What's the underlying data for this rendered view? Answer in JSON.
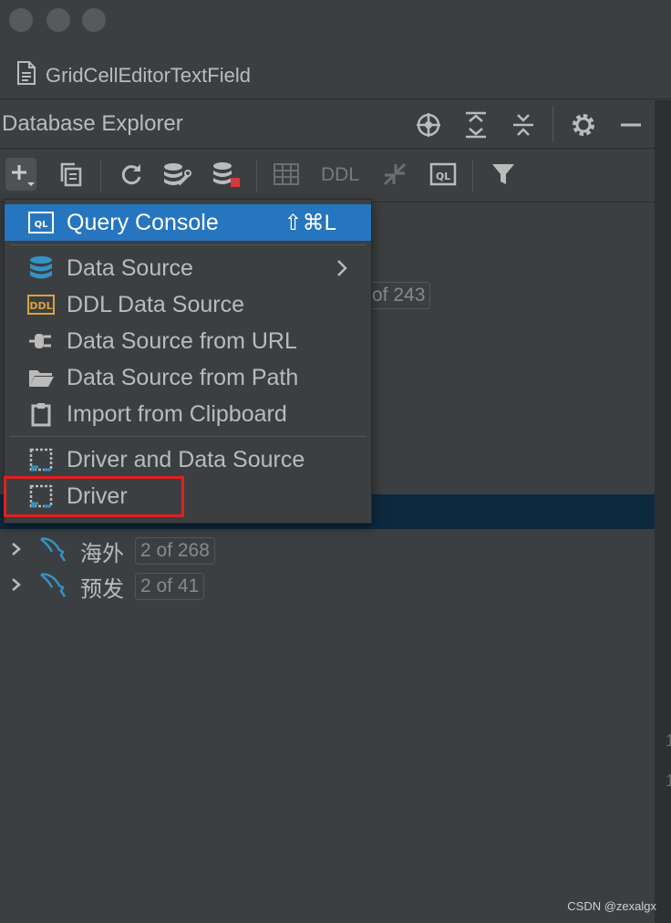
{
  "window": {
    "file_title": "GridCellEditorTextField"
  },
  "panel": {
    "title": "Database Explorer"
  },
  "toolbar": {
    "ddl_label": "DDL"
  },
  "popup_menu": {
    "items": [
      {
        "label": "Query Console",
        "shortcut": "⇧⌘L",
        "icon": "query-console-icon",
        "active": true
      },
      {
        "label": "Data Source",
        "icon": "data-source-icon",
        "submenu": true
      },
      {
        "label": "DDL Data Source",
        "icon": "ddl-icon"
      },
      {
        "label": "Data Source from URL",
        "icon": "plug-icon"
      },
      {
        "label": "Data Source from Path",
        "icon": "folder-icon"
      },
      {
        "label": "Import from Clipboard",
        "icon": "clipboard-icon"
      },
      {
        "label": "Driver and Data Source",
        "icon": "driver-icon"
      },
      {
        "label": "Driver",
        "icon": "driver-icon",
        "highlighted": true
      }
    ],
    "submenu_arrow": "›"
  },
  "tree": {
    "partial_badge": "of 243",
    "items": [
      {
        "label": "海外",
        "count": "2 of 268",
        "icon": "mysql-dolphin-icon"
      },
      {
        "label": "预发",
        "count": "2 of 41",
        "icon": "mysql-dolphin-icon"
      }
    ]
  },
  "gutter": {
    "num1": "1",
    "num2": "1"
  },
  "watermark": "CSDN @zexalgx",
  "colors": {
    "menu_active": "#2675bf",
    "selection": "#0d293e",
    "highlight_border": "#e02020",
    "icon_blue": "#3592c4"
  }
}
